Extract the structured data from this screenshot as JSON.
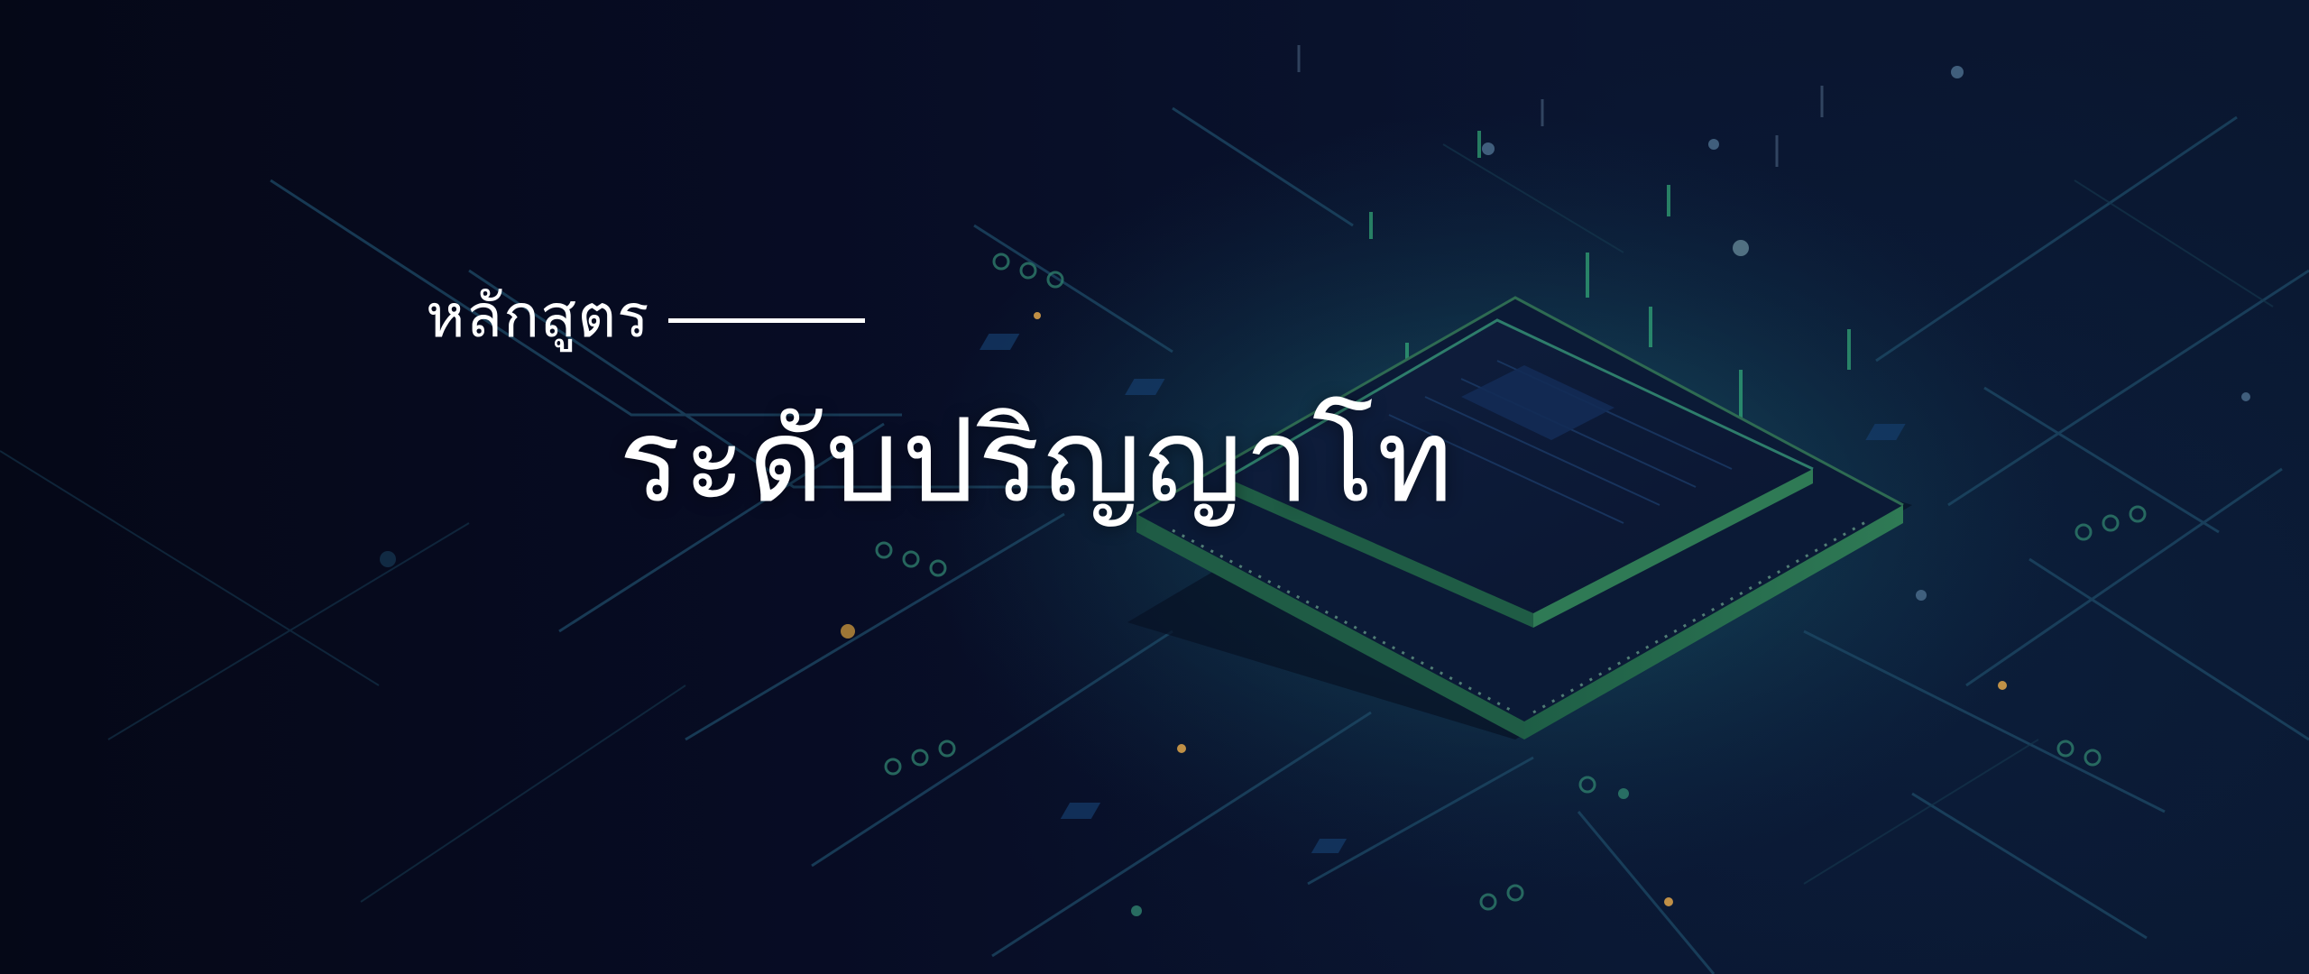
{
  "banner": {
    "eyebrow": "หลักสูตร",
    "title": "ระดับปริญญาโท"
  },
  "colors": {
    "background_dark": "#060a1f",
    "background_navy": "#0a1730",
    "chip_green": "#2f7a55",
    "circuit_teal": "#1e5a6e",
    "glow_green": "#3fd18a",
    "text": "#ffffff"
  },
  "artwork": {
    "icon": "microchip-on-circuit-board-icon"
  }
}
